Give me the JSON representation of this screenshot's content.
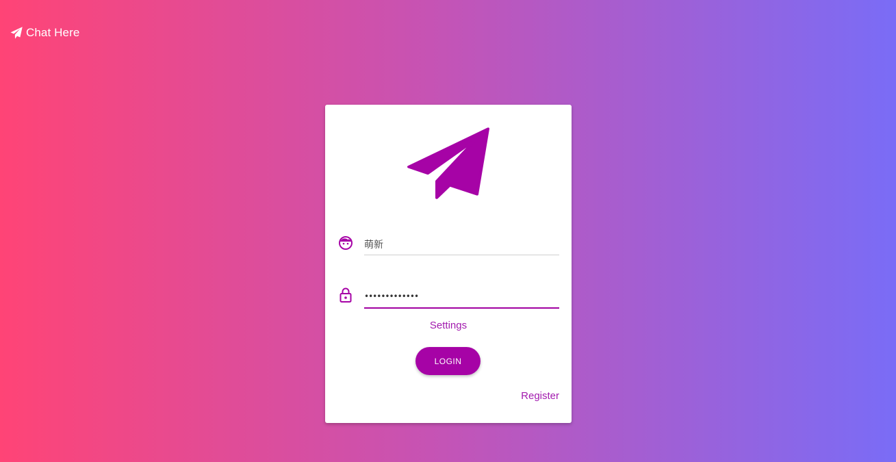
{
  "app": {
    "brand_name": "Chat Here",
    "brand_icon": "paper-plane-icon"
  },
  "login_card": {
    "logo_icon": "paper-plane-logo-icon",
    "username": {
      "icon": "face-icon",
      "value": "萌新"
    },
    "password": {
      "icon": "lock-icon",
      "value": "•••••••••••••"
    },
    "settings_label": "Settings",
    "login_label": "LOGIN",
    "register_label": "Register"
  },
  "colors": {
    "accent": "#a603a6",
    "gradient_start": "#ff4476",
    "gradient_end": "#7a6cf6",
    "card_background": "#ffffff"
  }
}
